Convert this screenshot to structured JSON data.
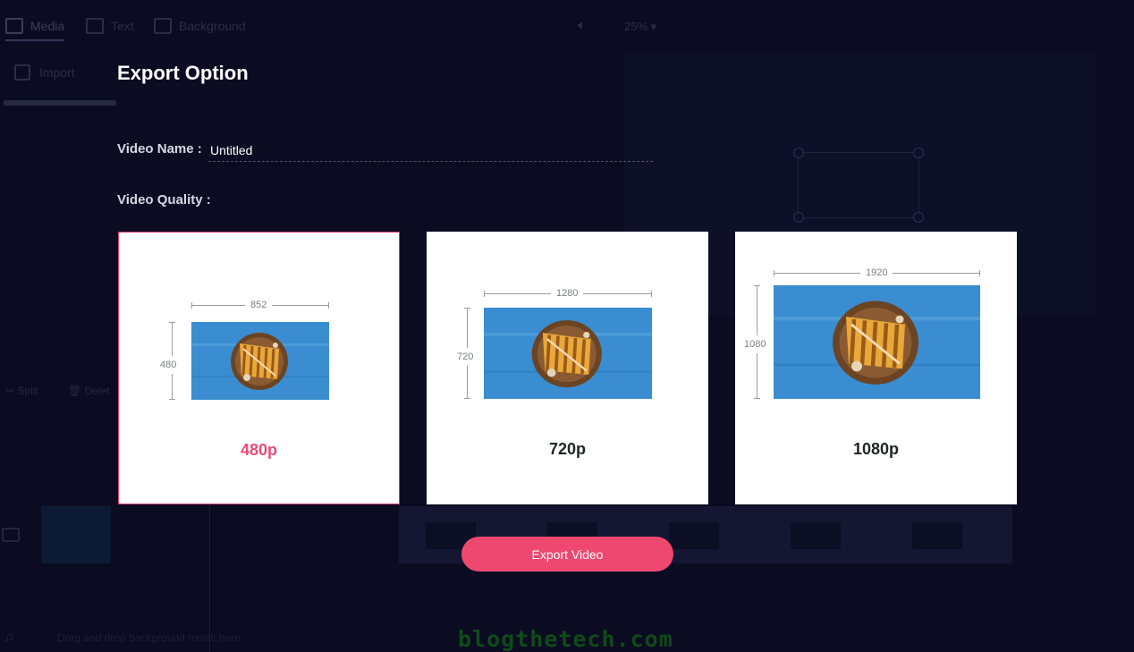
{
  "background_editor": {
    "tabs": [
      {
        "label": "Media",
        "icon": "media-icon"
      },
      {
        "label": "Text",
        "icon": "text-icon"
      },
      {
        "label": "Background",
        "icon": "background-icon"
      }
    ],
    "zoom": "25%",
    "import_label": "Import",
    "split_label": "Split",
    "delete_label": "Delet",
    "drag_hint": "Drag and drop background music here"
  },
  "modal": {
    "title": "Export Option",
    "video_name_label": "Video Name :",
    "video_name_value": "Untitled",
    "video_quality_label": "Video Quality :",
    "qualities": [
      {
        "label": "480p",
        "width": "852",
        "height": "480",
        "selected": true
      },
      {
        "label": "720p",
        "width": "1280",
        "height": "720",
        "selected": false
      },
      {
        "label": "1080p",
        "width": "1920",
        "height": "1080",
        "selected": false
      }
    ],
    "export_button": "Export Video"
  },
  "watermark": "blogthetech.com",
  "colors": {
    "accent": "#ef4870",
    "selected_label": "#ee4d79",
    "background": "#0b0c22",
    "card": "#ffffff"
  }
}
